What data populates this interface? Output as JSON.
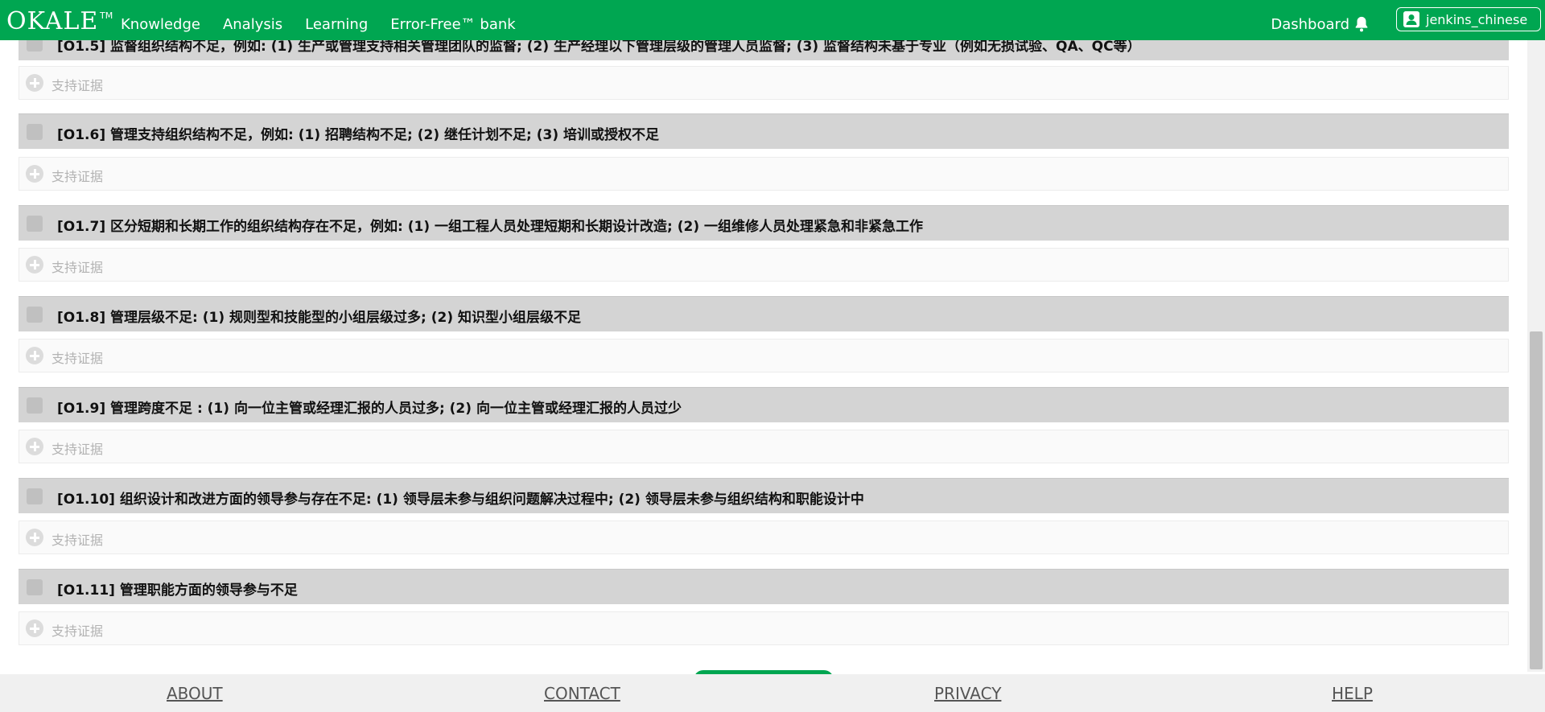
{
  "nav": {
    "logo": "OKALE",
    "logo_tm": "TM",
    "links": [
      "Knowledge",
      "Analysis",
      "Learning",
      "Error-Free™ bank"
    ],
    "dashboard": "Dashboard",
    "user": "jenkins_chinese"
  },
  "items": [
    {
      "code": "[O1.5]",
      "title": "[O1.5] 监督组织结构不足，例如: (1) 生产或管理支持相关管理团队的监督; (2) 生产经理以下管理层级的管理人员监督; (3) 监督结构未基于专业（例如无损试验、QA、QC等）",
      "evidence": "支持证据"
    },
    {
      "code": "[O1.6]",
      "title": "[O1.6] 管理支持组织结构不足，例如: (1) 招聘结构不足; (2) 继任计划不足; (3) 培训或授权不足",
      "evidence": "支持证据"
    },
    {
      "code": "[O1.7]",
      "title": "[O1.7] 区分短期和长期工作的组织结构存在不足，例如: (1) 一组工程人员处理短期和长期设计改造; (2) 一组维修人员处理紧急和非紧急工作",
      "evidence": "支持证据"
    },
    {
      "code": "[O1.8]",
      "title": "[O1.8] 管理层级不足: (1) 规则型和技能型的小组层级过多; (2) 知识型小组层级不足",
      "evidence": "支持证据"
    },
    {
      "code": "[O1.9]",
      "title": "[O1.9] 管理跨度不足 : (1) 向一位主管或经理汇报的人员过多; (2) 向一位主管或经理汇报的人员过少",
      "evidence": "支持证据"
    },
    {
      "code": "[O1.10]",
      "title": "[O1.10] 组织设计和改进方面的领导参与存在不足: (1) 领导层未参与组织问题解决过程中; (2) 领导层未参与组织结构和职能设计中",
      "evidence": "支持证据"
    },
    {
      "code": "[O1.11]",
      "title": "[O1.11] 管理职能方面的领导参与不足",
      "evidence": "支持证据"
    }
  ],
  "footer": {
    "about": "ABOUT",
    "contact": "CONTACT",
    "privacy": "PRIVACY",
    "help": "HELP"
  },
  "colors": {
    "brand_green": "#00a651",
    "header_gray": "#d4d4d4",
    "footer_bg": "#f0f0f0"
  }
}
